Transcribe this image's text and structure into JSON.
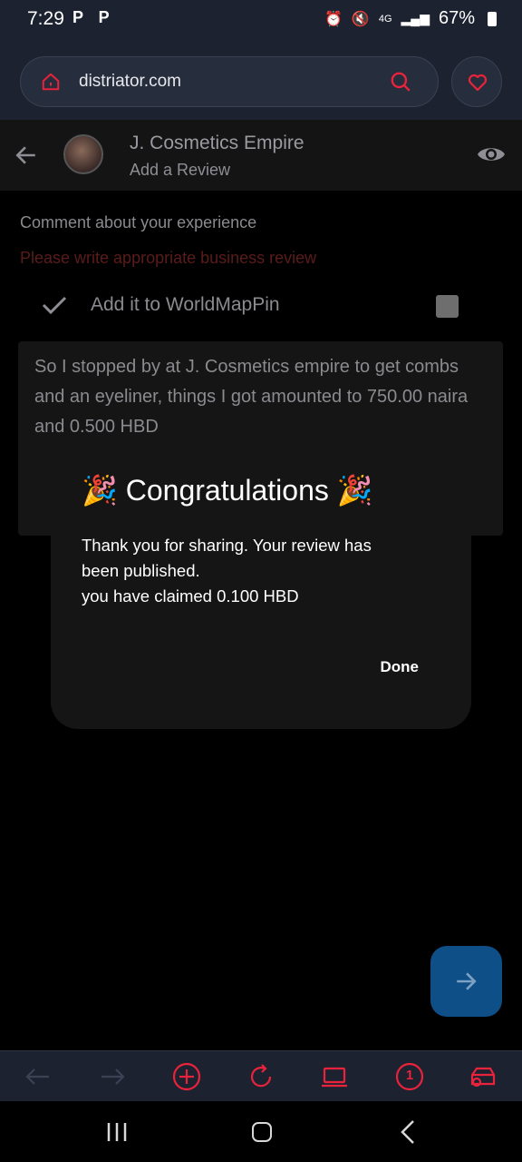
{
  "status": {
    "time": "7:29",
    "left_icons": "P P",
    "network": "4G",
    "battery": "67%"
  },
  "browser": {
    "url": "distriator.com"
  },
  "header": {
    "business_name": "J. Cosmetics Empire",
    "subtitle": "Add a Review"
  },
  "form": {
    "comment_label": "Comment about your experience",
    "warning": "Please write appropriate business review",
    "worldmappin_label": "Add it to WorldMapPin",
    "review_text": "So I stopped by at J. Cosmetics empire to get combs and an eyeliner, things I got amounted to 750.00 naira and 0.500 HBD"
  },
  "dialog": {
    "title": "🎉 Congratulations 🎉",
    "line1": "Thank you for sharing. Your review has",
    "line2": "been published.",
    "line3": "you have claimed 0.100 HBD",
    "done_label": "Done"
  },
  "toolbar": {
    "tabs_count": "1"
  },
  "colors": {
    "accent_red": "#e8233b",
    "fab_blue": "#0f4f87",
    "chrome_bg": "#1c2230"
  },
  "icons": [
    "home-icon",
    "search-icon",
    "heart-icon",
    "back-arrow-icon",
    "eye-icon",
    "check-icon",
    "arrow-right-icon",
    "forward-icon",
    "add-tab-icon",
    "reload-icon",
    "laptop-icon",
    "tabs-icon",
    "wallet-icon"
  ]
}
